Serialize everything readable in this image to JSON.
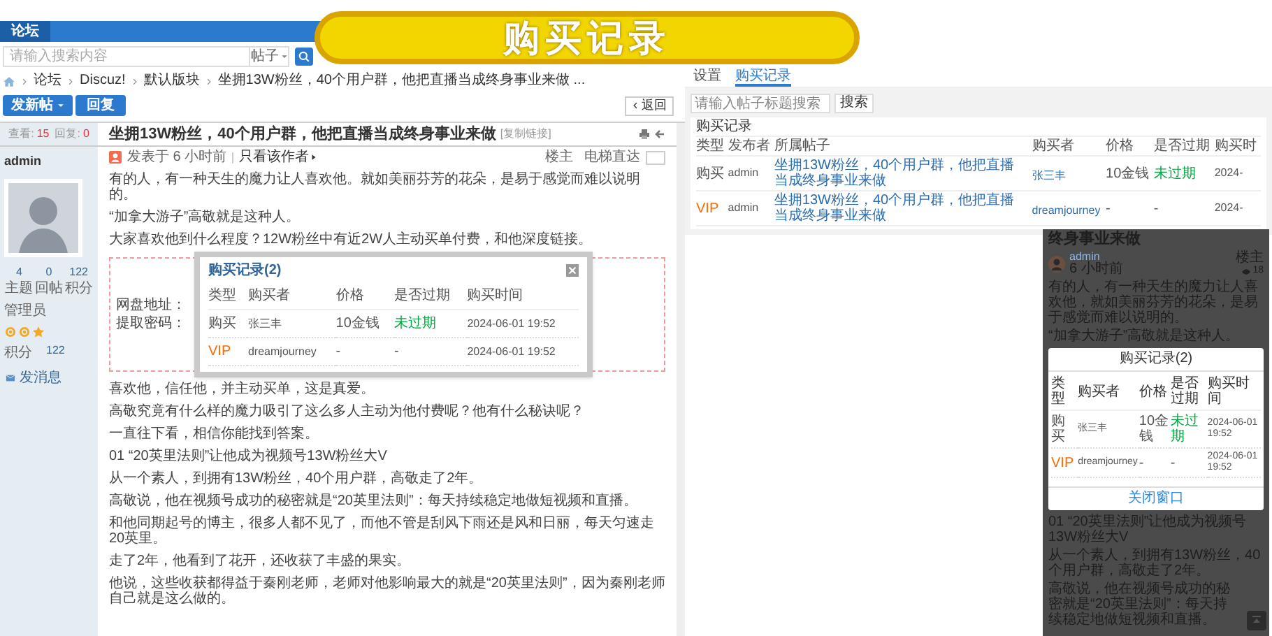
{
  "banner": {
    "title": "购买记录"
  },
  "forum": {
    "nav_tab": "论坛",
    "search": {
      "placeholder": "请输入搜索内容",
      "scope": "帖子"
    },
    "breadcrumb": [
      "论坛",
      "Discuz!",
      "默认版块",
      "坐拥13W粉丝，40个用户群，他把直播当成终身事业来做 ..."
    ],
    "new_post_button": "发新帖",
    "reply_button": "回复",
    "back_button": "返回",
    "stats": {
      "views_label": "查看:",
      "views": "15",
      "replies_label": "回复:",
      "replies": "0"
    },
    "thread_title": "坐拥13W粉丝，40个用户群，他把直播当成终身事业来做",
    "copy_link": "[复制链接]",
    "author": {
      "name": "admin",
      "counts": [
        {
          "value": "4",
          "label": "主题"
        },
        {
          "value": "0",
          "label": "回帖"
        },
        {
          "value": "122",
          "label": "积分"
        }
      ],
      "group": "管理员",
      "points_label": "积分",
      "points": "122",
      "message_link": "发消息"
    },
    "post_meta": {
      "posted": "发表于 6 小时前",
      "author_only": "只看该作者",
      "floor": "楼主",
      "jump_label": "电梯直达"
    },
    "paragraphs_before": [
      "有的人，有一种天生的魔力让人喜欢他。就如美丽芬芳的花朵，是易于感觉而难以说明的。",
      "“加拿大游子”高敬就是这种人。",
      "大家喜欢他到什么程度？12W粉丝中有近2W人主动买单付费，和他深度链接。"
    ],
    "attachment_lines": [
      "网盘地址：",
      "提取密码："
    ],
    "purchase_popup": {
      "title": "购买记录(2)",
      "columns": [
        "类型",
        "购买者",
        "价格",
        "是否过期",
        "购买时间"
      ],
      "rows": [
        {
          "kind": "purchase",
          "type": "购买",
          "buyer": "张三丰",
          "price": "10金钱",
          "expired": false,
          "expiry": "未过期",
          "time": "2024-06-01 19:52"
        },
        {
          "kind": "vip",
          "type": "VIP",
          "buyer": "dreamjourney",
          "price": "-",
          "expiry": "-",
          "time": "2024-06-01 19:52"
        }
      ]
    },
    "paragraphs_after": [
      "喜欢他，信任他，并主动买单，这是真爱。",
      "高敬究竟有什么样的魔力吸引了这么多人主动为他付费呢？他有什么秘诀呢？",
      "一直往下看，相信你能找到答案。",
      "01 “20英里法则”让他成为视频号13W粉丝大V",
      "从一个素人，到拥有13W粉丝，40个用户群，高敬走了2年。",
      "高敬说，他在视频号成功的秘密就是“20英里法则”：每天持续稳定地做短视频和直播。",
      "和他同期起号的博主，很多人都不见了，而他不管是刮风下雨还是风和日丽，每天匀速走20英里。",
      "走了2年，他看到了花开，还收获了丰盛的果实。",
      "他说，这些收获都得益于秦刚老师，老师对他影响最大的就是“20英里法则”，因为秦刚老师自己就是这么做的。"
    ]
  },
  "admin": {
    "tabs": [
      {
        "label": "设置",
        "selected": false
      },
      {
        "label": "购买记录",
        "selected": true
      }
    ],
    "search": {
      "placeholder": "请输入帖子标题搜索",
      "button": "搜索"
    },
    "card_title": "购买记录",
    "columns": [
      "类型",
      "发布者",
      "所属帖子",
      "购买者",
      "价格",
      "是否过期",
      "购买时"
    ],
    "rows": [
      {
        "kind": "purchase",
        "type": "购买",
        "publisher": "admin",
        "post": "坐拥13W粉丝，40个用户群，他把直播当成终身事业来做",
        "buyer": "张三丰",
        "price": "10金钱",
        "expired": false,
        "expiry": "未过期",
        "time": "2024-"
      },
      {
        "kind": "vip",
        "type": "VIP",
        "publisher": "admin",
        "post": "坐拥13W粉丝，40个用户群，他把直播当成终身事业来做",
        "buyer": "dreamjourney",
        "price": "-",
        "expiry": "-",
        "time": "2024-"
      }
    ]
  },
  "mobile": {
    "title": "终身事业来做",
    "author": "admin",
    "time": "6 小时前",
    "floor": "楼主",
    "views": "18",
    "paragraphs_top": [
      "有的人，有一种天生的魔力让人喜欢他，就如美丽芬芳的花朵，是易于感觉而难以说明的。",
      "“加拿大游子”高敬就是这种人。"
    ],
    "modal": {
      "title": "购买记录(2)",
      "columns": [
        "类型",
        "购买者",
        "价格",
        "是否过期",
        "购买时间"
      ],
      "rows": [
        {
          "kind": "purchase",
          "type": "购买",
          "buyer": "张三丰",
          "price": "10金钱",
          "expired": false,
          "expiry": "未过期",
          "time": "2024-06-01 19:52"
        },
        {
          "kind": "vip",
          "type": "VIP",
          "buyer": "dreamjourney",
          "price": "-",
          "expiry": "-",
          "time": "2024-06-01 19:52"
        }
      ],
      "close_button": "关闭窗口"
    },
    "paragraphs_bottom": [
      "01 “20英里法则”让他成为视频号13W粉丝大V",
      "从一个素人，到拥有13W粉丝，40个用户群，高敬走了2年。",
      "高敬说，他在视频号成功的秘密就是“20英里法则”：每天持续稳定地做短视频和直播。"
    ]
  }
}
